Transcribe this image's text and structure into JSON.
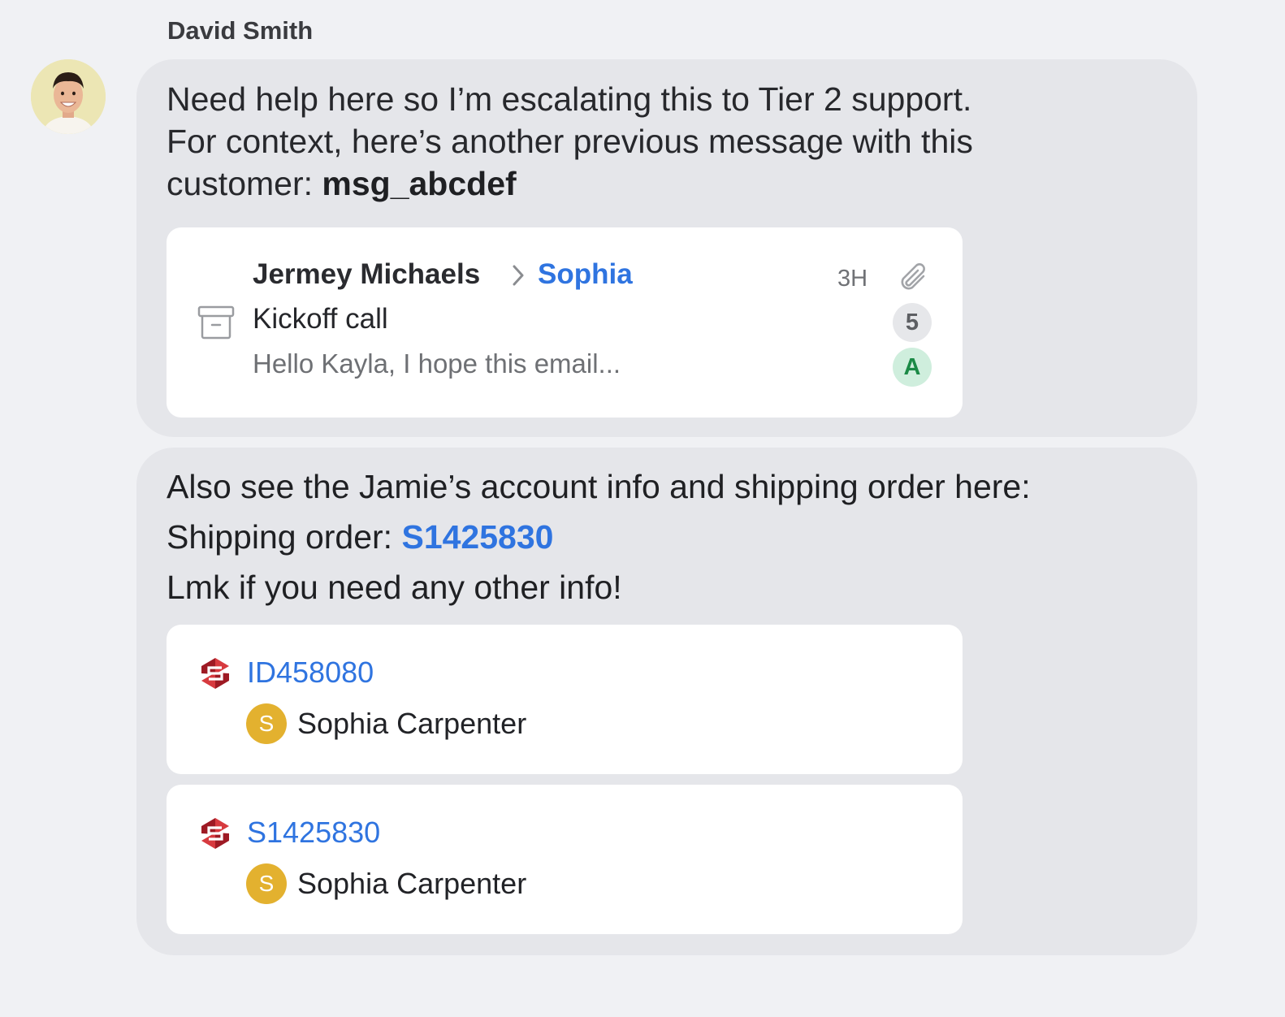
{
  "sender": {
    "name": "David Smith"
  },
  "messages": [
    {
      "text_line1": "Need help here so I’m escalating this to Tier 2 support.",
      "text_line2": "For context, here’s another previous message with this",
      "text_line3_prefix": "customer: ",
      "message_ref": "msg_abcdef",
      "email_card": {
        "from": "Jermey Michaels",
        "to": "Sophia",
        "time": "3H",
        "subject": "Kickoff call",
        "preview": "Hello Kayla, I hope this email...",
        "count": "5",
        "assignee_initial": "A",
        "icons": [
          "archive-icon",
          "paperclip-icon",
          "chevron-right-icon"
        ]
      }
    },
    {
      "line1": "Also see the Jamie’s account info and shipping order here:",
      "line2_prefix": "Shipping order: ",
      "shipping_order": "S1425830",
      "line3": "Lmk if you need any other info!",
      "records": [
        {
          "id": "ID458080",
          "owner_initial": "S",
          "owner": "Sophia Carpenter"
        },
        {
          "id": "S1425830",
          "owner_initial": "S",
          "owner": "Sophia Carpenter"
        }
      ]
    }
  ],
  "colors": {
    "background": "#f0f1f4",
    "bubble": "#e5e6ea",
    "link": "#2f74e0",
    "owner_avatar": "#e3b12f",
    "assignee_badge": "#cfeedd",
    "logo_red": "#c0262f"
  }
}
